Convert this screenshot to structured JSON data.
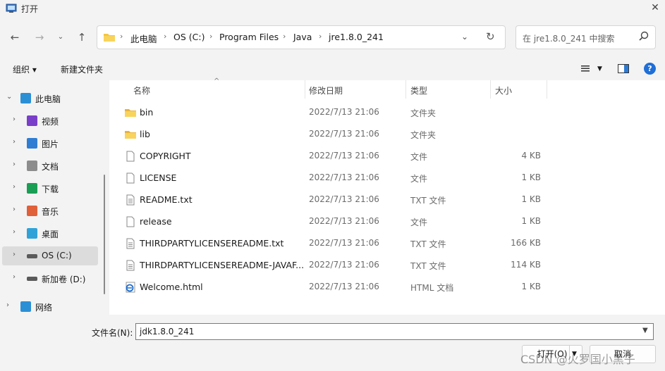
{
  "window": {
    "title": "打开"
  },
  "address": {
    "crumbs": [
      "此电脑",
      "OS (C:)",
      "Program Files",
      "Java",
      "jre1.8.0_241"
    ]
  },
  "search": {
    "placeholder": "在 jre1.8.0_241 中搜索"
  },
  "toolbar": {
    "organize": "组织 ▾",
    "new_folder": "新建文件夹"
  },
  "nav_pane": {
    "items": [
      {
        "label": "此电脑",
        "icon": "computer-icon",
        "color": "#2b8fd6",
        "expanded": true
      },
      {
        "label": "视频",
        "icon": "video-icon",
        "color": "#7a3fc9"
      },
      {
        "label": "图片",
        "icon": "pictures-icon",
        "color": "#2f7dd3"
      },
      {
        "label": "文档",
        "icon": "documents-icon",
        "color": "#8c8c8c"
      },
      {
        "label": "下载",
        "icon": "download-icon",
        "color": "#1a9e55"
      },
      {
        "label": "音乐",
        "icon": "music-icon",
        "color": "#e0603a"
      },
      {
        "label": "桌面",
        "icon": "desktop-icon",
        "color": "#2fa3d8"
      },
      {
        "label": "OS (C:)",
        "icon": "drive-icon",
        "color": "#5a5a5a",
        "selected": true
      },
      {
        "label": "新加卷 (D:)",
        "icon": "drive-icon",
        "color": "#5a5a5a"
      },
      {
        "label": "网络",
        "icon": "network-icon",
        "color": "#2b8fd6"
      }
    ]
  },
  "columns": {
    "name": "名称",
    "date": "修改日期",
    "type": "类型",
    "size": "大小"
  },
  "files": [
    {
      "name": "bin",
      "date": "2022/7/13 21:06",
      "type": "文件夹",
      "size": "",
      "kind": "folder"
    },
    {
      "name": "lib",
      "date": "2022/7/13 21:06",
      "type": "文件夹",
      "size": "",
      "kind": "folder"
    },
    {
      "name": "COPYRIGHT",
      "date": "2022/7/13 21:06",
      "type": "文件",
      "size": "4 KB",
      "kind": "file"
    },
    {
      "name": "LICENSE",
      "date": "2022/7/13 21:06",
      "type": "文件",
      "size": "1 KB",
      "kind": "file"
    },
    {
      "name": "README.txt",
      "date": "2022/7/13 21:06",
      "type": "TXT 文件",
      "size": "1 KB",
      "kind": "txt"
    },
    {
      "name": "release",
      "date": "2022/7/13 21:06",
      "type": "文件",
      "size": "1 KB",
      "kind": "file"
    },
    {
      "name": "THIRDPARTYLICENSEREADME.txt",
      "date": "2022/7/13 21:06",
      "type": "TXT 文件",
      "size": "166 KB",
      "kind": "txt"
    },
    {
      "name": "THIRDPARTYLICENSEREADME-JAVAF...",
      "date": "2022/7/13 21:06",
      "type": "TXT 文件",
      "size": "114 KB",
      "kind": "txt"
    },
    {
      "name": "Welcome.html",
      "date": "2022/7/13 21:06",
      "type": "HTML 文档",
      "size": "1 KB",
      "kind": "html"
    }
  ],
  "bottom": {
    "filename_label": "文件名(N):",
    "filename_value": "jdk1.8.0_241",
    "open_label": "打开(O)",
    "cancel_label": "取消"
  },
  "watermark": "CSDN @火罗国小黑子"
}
